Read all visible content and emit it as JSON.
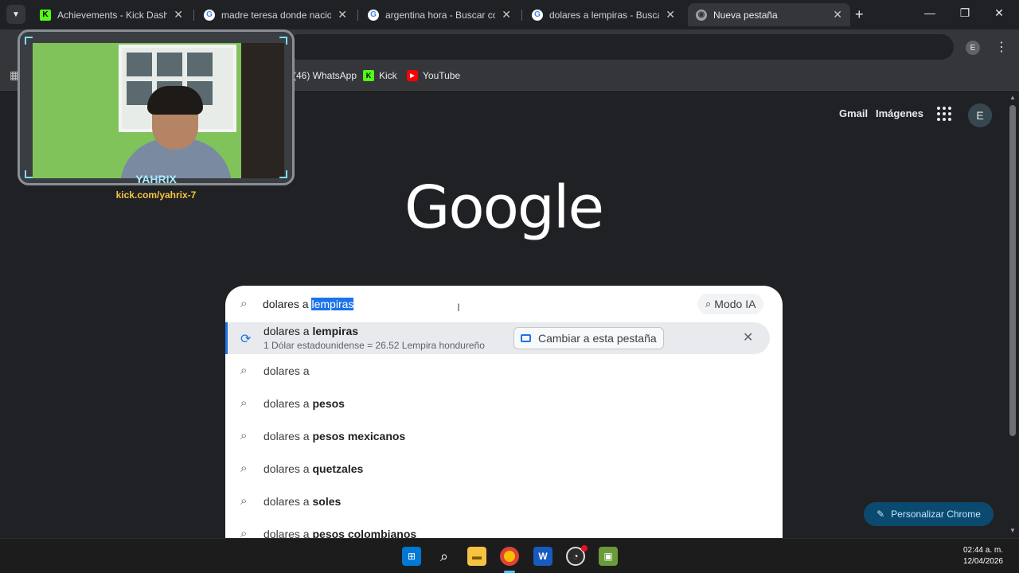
{
  "tabs": [
    {
      "label": "Achievements - Kick Dashbo",
      "favicon": "kick-icon"
    },
    {
      "label": "madre teresa donde nacio -",
      "favicon": "google-icon"
    },
    {
      "label": "argentina hora - Buscar con",
      "favicon": "google-icon"
    },
    {
      "label": "dolares a lempiras - Buscar c",
      "favicon": "google-icon"
    },
    {
      "label": "Nueva pestaña",
      "favicon": "chrome-icon"
    }
  ],
  "toolbar": {
    "profile_initial": "E"
  },
  "bookmarks": [
    {
      "label": "(46) WhatsApp"
    },
    {
      "label": "Kick"
    },
    {
      "label": "YouTube"
    }
  ],
  "page": {
    "gmail": "Gmail",
    "images": "Imágenes",
    "avatar": "E",
    "logo": "Google",
    "customize": "Personalizar Chrome"
  },
  "search": {
    "query_plain": "dolares a ",
    "query_selected": "lempiras",
    "ai_mode": "Modo IA"
  },
  "active_suggestion": {
    "title_plain": "dolares a ",
    "title_bold": "lempiras",
    "subtitle": "1 Dólar estadounidense = 26.52 Lempira hondureño",
    "switch_label": "Cambiar a esta pestaña"
  },
  "suggestions": [
    {
      "plain": "dolares a",
      "bold": ""
    },
    {
      "plain": "dolares a ",
      "bold": "pesos"
    },
    {
      "plain": "dolares a ",
      "bold": "pesos mexicanos"
    },
    {
      "plain": "dolares a ",
      "bold": "quetzales"
    },
    {
      "plain": "dolares a ",
      "bold": "soles"
    },
    {
      "plain": "dolares a ",
      "bold": "pesos colombianos"
    }
  ],
  "webcam": {
    "name": "YAHRIX",
    "url": "kick.com/yahrix-7"
  },
  "taskbar": {
    "time": "02:44 a. m.",
    "date": "12/04/2026"
  },
  "colors": {
    "accent": "#1a73e8",
    "kick": "#53fc18",
    "page_bg": "#202124"
  }
}
